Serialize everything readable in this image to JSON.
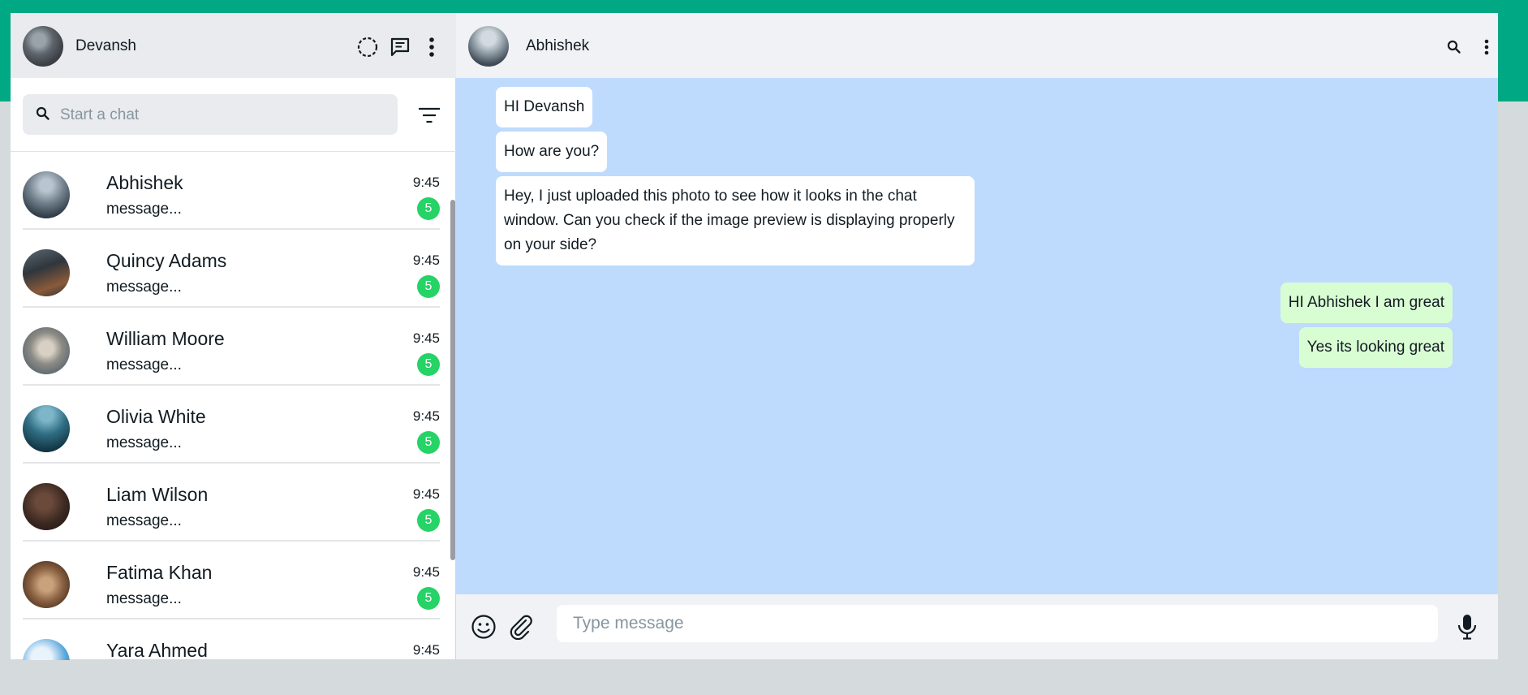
{
  "colors": {
    "brand_band": "#00a884",
    "chat_background": "#bedbfd",
    "incoming_bubble": "#ffffff",
    "outgoing_bubble": "#d9fdd3",
    "unread_badge": "#25d366"
  },
  "sidebar": {
    "user_name": "Devansh",
    "header_icons": [
      "status-icon",
      "new-chat-icon",
      "menu-icon"
    ],
    "search": {
      "placeholder": "Start a chat",
      "value": ""
    },
    "chats": [
      {
        "name": "Abhishek",
        "preview": "message...",
        "time": "9:45",
        "unread": "5"
      },
      {
        "name": "Quincy Adams",
        "preview": "message...",
        "time": "9:45",
        "unread": "5"
      },
      {
        "name": "William Moore",
        "preview": "message...",
        "time": "9:45",
        "unread": "5"
      },
      {
        "name": "Olivia White",
        "preview": "message...",
        "time": "9:45",
        "unread": "5"
      },
      {
        "name": "Liam Wilson",
        "preview": "message...",
        "time": "9:45",
        "unread": "5"
      },
      {
        "name": "Fatima Khan",
        "preview": "message...",
        "time": "9:45",
        "unread": "5"
      },
      {
        "name": "Yara Ahmed",
        "preview": "",
        "time": "9:45",
        "unread": ""
      }
    ]
  },
  "conversation": {
    "peer_name": "Abhishek",
    "header_icons": [
      "search-icon",
      "menu-icon"
    ],
    "messages": [
      {
        "direction": "in",
        "text": "HI Devansh"
      },
      {
        "direction": "in",
        "text": "How are you?"
      },
      {
        "direction": "in",
        "text": "Hey, I just uploaded this photo to see how it looks in the chat window. Can you check if the image preview is displaying properly on your side?"
      },
      {
        "direction": "out",
        "text": "HI Abhishek I am great"
      },
      {
        "direction": "out",
        "text": "Yes its looking great"
      }
    ],
    "composer": {
      "placeholder": "Type message",
      "value": ""
    }
  }
}
